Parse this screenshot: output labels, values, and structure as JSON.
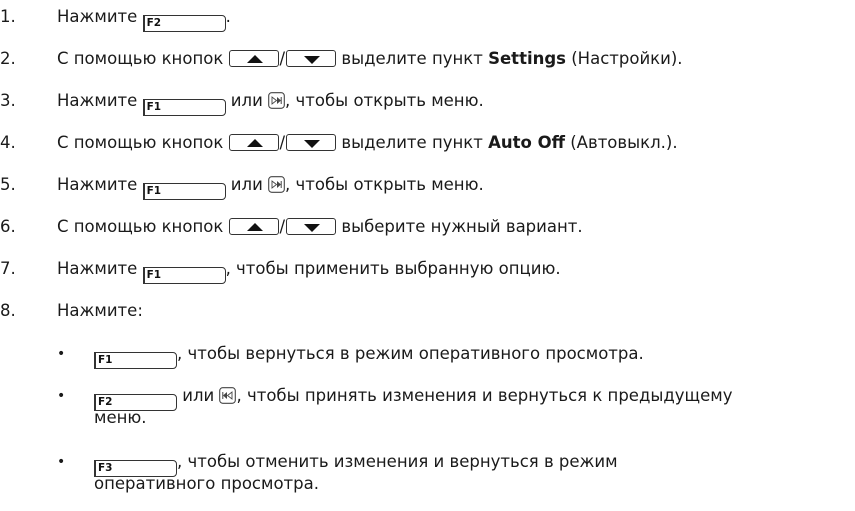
{
  "steps": [
    {
      "num": "1.",
      "a": "Нажмите ",
      "key": "F2",
      "b": "."
    },
    {
      "num": "2.",
      "a": "С помощью кнопок ",
      "b": " выделите пункт ",
      "bold": "Settings",
      "c": " (Настройки)."
    },
    {
      "num": "3.",
      "a": "Нажмите ",
      "key": "F1",
      "b": " или ",
      "c": ", чтобы открыть меню."
    },
    {
      "num": "4.",
      "a": "С помощью кнопок ",
      "b": " выделите пункт ",
      "bold": "Auto Off",
      "c": " (Автовыкл.)."
    },
    {
      "num": "5.",
      "a": "Нажмите ",
      "key": "F1",
      "b": " или ",
      "c": ", чтобы открыть меню."
    },
    {
      "num": "6.",
      "a": "С помощью кнопок ",
      "b": " выберите нужный вариант."
    },
    {
      "num": "7.",
      "a": "Нажмите ",
      "key": "F1",
      "b": ", чтобы применить выбранную опцию."
    },
    {
      "num": "8.",
      "a": "Нажмите:"
    }
  ],
  "bullets": [
    {
      "dot": "•",
      "key": "F1",
      "a": ", чтобы вернуться в режим оперативного просмотра."
    },
    {
      "dot": "•",
      "key": "F2",
      "a": " или ",
      "b": ", чтобы принять изменения и вернуться к предыдущему",
      "c": "меню."
    },
    {
      "dot": "•",
      "key": "F3",
      "a": ", чтобы отменить изменения и вернуться в режим",
      "c": "оперативного просмотра."
    }
  ],
  "icons": {
    "up": "up-arrow-key-icon",
    "down": "down-arrow-key-icon",
    "forward": "forward-key-icon",
    "back": "back-key-icon"
  }
}
